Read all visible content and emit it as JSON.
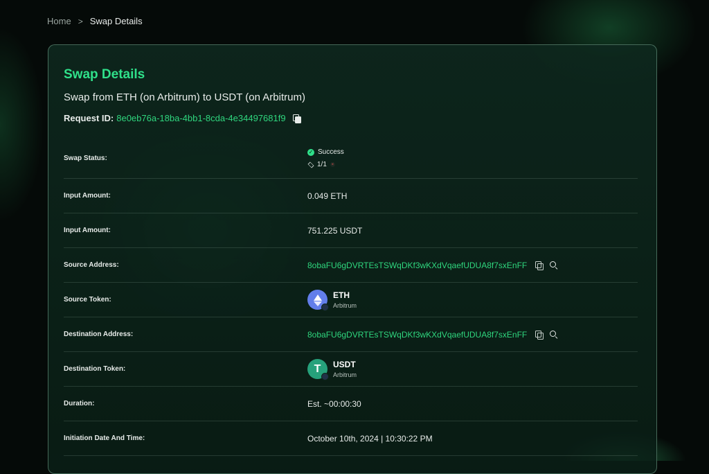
{
  "breadcrumb": {
    "home": "Home",
    "separator": ">",
    "current": "Swap Details"
  },
  "card": {
    "title": "Swap Details",
    "subtitle": "Swap from ETH (on Arbitrum) to USDT (on Arbitrum)",
    "request_label": "Request ID:",
    "request_id": "8e0eb76a-18ba-4bb1-8cda-4e34497681f9"
  },
  "rows": {
    "swap_status": {
      "label": "Swap Status:",
      "status": "Success",
      "steps": "1/1"
    },
    "input_amount": {
      "label": "Input Amount:",
      "value": "0.049 ETH"
    },
    "output_amount": {
      "label": "Input Amount:",
      "value": "751.225 USDT"
    },
    "source_address": {
      "label": "Source Address:",
      "value": "8obaFU6gDVRTEsTSWqDKf3wKXdVqaefUDUA8f7sxEnFF"
    },
    "source_token": {
      "label": "Source Token:",
      "symbol": "ETH",
      "chain": "Arbitrum"
    },
    "destination_address": {
      "label": "Destination Address:",
      "value": "8obaFU6gDVRTEsTSWqDKf3wKXdVqaefUDUA8f7sxEnFF"
    },
    "destination_token": {
      "label": "Destination Token:",
      "symbol": "USDT",
      "chain": "Arbitrum"
    },
    "duration": {
      "label": "Duration:",
      "value": "Est. ~00:00:30"
    },
    "initiation": {
      "label": "Initiation Date And Time:",
      "value": "October 10th, 2024 | 10:30:22 PM"
    }
  },
  "colors": {
    "accent": "#2fe08a",
    "link": "#2fd67e",
    "eth": "#627eea",
    "usdt": "#26a17b"
  }
}
